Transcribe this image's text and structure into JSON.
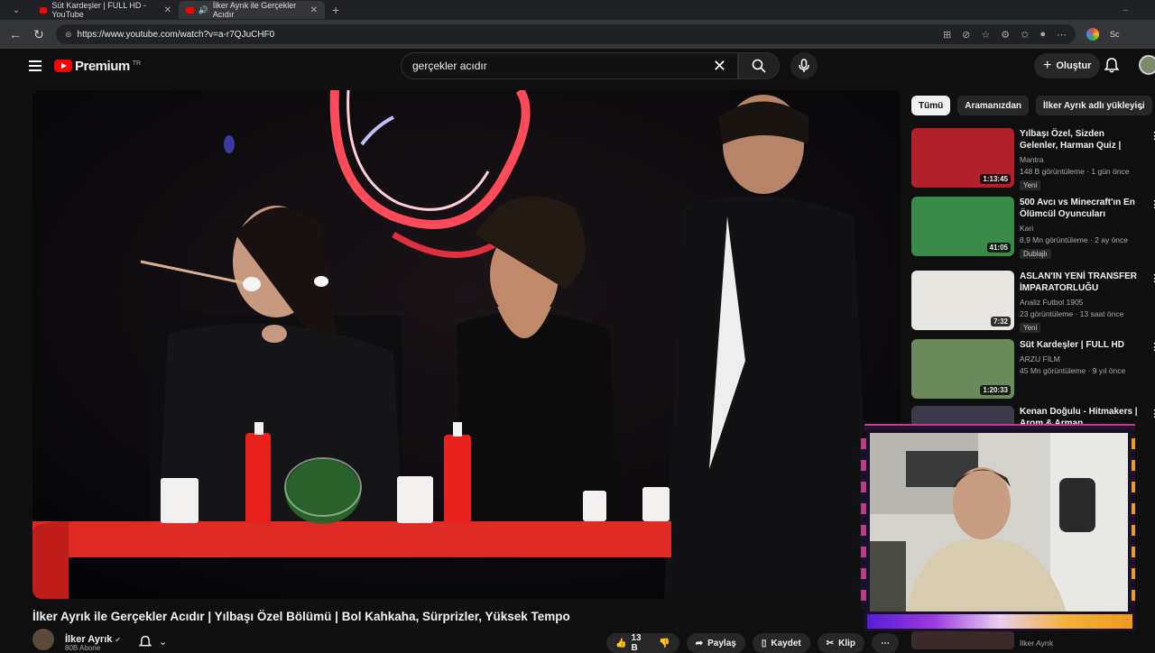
{
  "browser": {
    "tabs": [
      {
        "title": "Süt Kardeşler | FULL HD - YouTube",
        "active": false
      },
      {
        "title": "İlker Ayrık ile Gerçekler Acıdır",
        "active": true
      }
    ],
    "url": "https://www.youtube.com/watch?v=a-r7QJuCHF0",
    "extension_label": "Sc"
  },
  "header": {
    "logo": "Premium",
    "country": "TR",
    "search_query": "gerçekler acıdır",
    "create_label": "Oluştur"
  },
  "video": {
    "title": "İlker Ayrık ile Gerçekler Acıdır | Yılbaşı Özel Bölümü | Bol Kahkaha, Sürprizler, Yüksek Tempo",
    "channel": "İlker Ayrık",
    "subscribers": "80B Abone",
    "likes": "13 B",
    "share": "Paylaş",
    "save": "Kaydet",
    "clip": "Klip"
  },
  "chips": [
    "Tümü",
    "Aramanızdan",
    "İlker Ayrık adlı yükleyici"
  ],
  "recommendations": [
    {
      "title": "Yılbaşı Özel, Sizden Gelenler, Harman Quiz | Erman Yaşar & ...",
      "channel": "Mantra",
      "meta": "148 B görüntüleme · 1 gün önce",
      "badge": "Yeni",
      "duration": "1:13:45",
      "thumb_color": "#b2202a"
    },
    {
      "title": "500 Avcı vs Minecraft'ın En Ölümcül Oyuncuları",
      "channel": "Kari",
      "meta": "8,9 Mn görüntüleme · 2 ay önce",
      "badge": "Dublajlı",
      "duration": "41:05",
      "thumb_color": "#3a8a4a"
    },
    {
      "title": "ASLAN'IN YENİ TRANSFER İMPARATORLUĞU YILDIZLARI",
      "channel": "Analiz Futbol 1905",
      "meta": "23 görüntüleme · 13 saat önce",
      "badge": "Yeni",
      "duration": "7:32",
      "thumb_color": "#e8e6e0"
    },
    {
      "title": "Süt Kardeşler | FULL HD",
      "channel": "ARZU FİLM",
      "meta": "45 Mn görüntüleme · 9 yıl önce",
      "badge": "",
      "duration": "1:20:33",
      "thumb_color": "#6a8a5a"
    },
    {
      "title": "Kenan Doğulu - Hitmakers | Arom & Arman",
      "channel": "",
      "meta": "",
      "badge": "",
      "duration": "",
      "thumb_color": "#3a3a4a"
    }
  ],
  "bottom_channel": "İlker Ayrık"
}
